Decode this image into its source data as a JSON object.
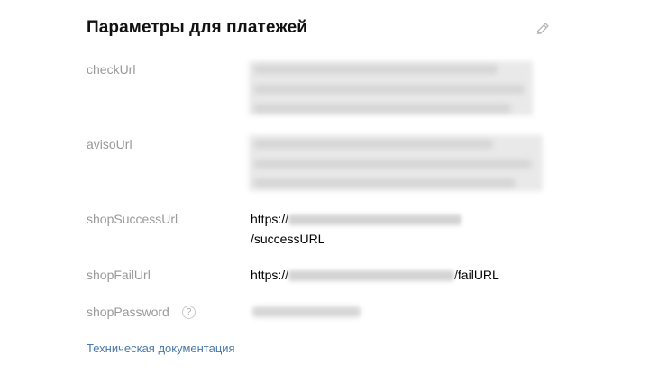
{
  "section": {
    "title": "Параметры для платежей"
  },
  "icons": {
    "edit": "pencil-icon",
    "help": "question-circle-icon"
  },
  "fields": {
    "check_url": {
      "label": "checkUrl"
    },
    "aviso_url": {
      "label": "avisoUrl"
    },
    "shop_success_url": {
      "label": "shopSuccessUrl",
      "prefix": "https://",
      "suffix": "/successURL"
    },
    "shop_fail_url": {
      "label": "shopFailUrl",
      "prefix": "https://",
      "suffix": "/failURL"
    },
    "shop_password": {
      "label": "shopPassword",
      "help_glyph": "?"
    }
  },
  "docs_link": {
    "label": "Техническая документация"
  },
  "colors": {
    "label_gray": "#999999",
    "link_blue": "#4a78a8",
    "title": "#111111"
  }
}
